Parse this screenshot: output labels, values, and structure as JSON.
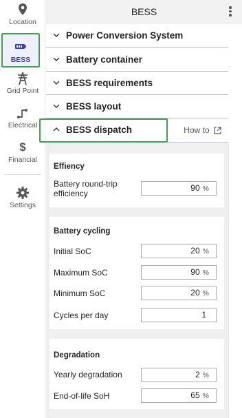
{
  "sidebar": {
    "items": [
      {
        "label": "Location",
        "icon": "map-pin-icon"
      },
      {
        "label": "BESS",
        "icon": "battery-icon",
        "active": true
      },
      {
        "label": "Grid Point",
        "icon": "transmission-tower-icon"
      },
      {
        "label": "Electrical",
        "icon": "electrical-route-icon"
      },
      {
        "label": "Financial",
        "icon": "dollar-icon"
      },
      {
        "label": "Settings",
        "icon": "gear-icon"
      }
    ]
  },
  "header": {
    "title": "BESS"
  },
  "sections": [
    {
      "label": "Power Conversion System",
      "expanded": false
    },
    {
      "label": "Battery container",
      "expanded": false
    },
    {
      "label": "BESS requirements",
      "expanded": false
    },
    {
      "label": "BESS layout",
      "expanded": false
    },
    {
      "label": "BESS dispatch",
      "expanded": true,
      "link": "How to"
    }
  ],
  "efficiency": {
    "title": "Effiency",
    "rows": [
      {
        "label": "Battery round-trip efficiency",
        "value": "90",
        "unit": "%"
      }
    ]
  },
  "cycling": {
    "title": "Battery cycling",
    "rows": [
      {
        "label": "Initial SoC",
        "value": "20",
        "unit": "%"
      },
      {
        "label": "Maximum SoC",
        "value": "90",
        "unit": "%"
      },
      {
        "label": "Minimum SoC",
        "value": "20",
        "unit": "%"
      },
      {
        "label": "Cycles per day",
        "value": "1",
        "unit": ""
      }
    ]
  },
  "degradation": {
    "title": "Degradation",
    "rows": [
      {
        "label": "Yearly degradation",
        "value": "2",
        "unit": "%"
      },
      {
        "label": "End-of-life SoH",
        "value": "65",
        "unit": "%"
      }
    ]
  },
  "colors": {
    "accent": "#3d3fb0",
    "highlight": "#3fa34d",
    "divider": "#b7b8d8"
  }
}
